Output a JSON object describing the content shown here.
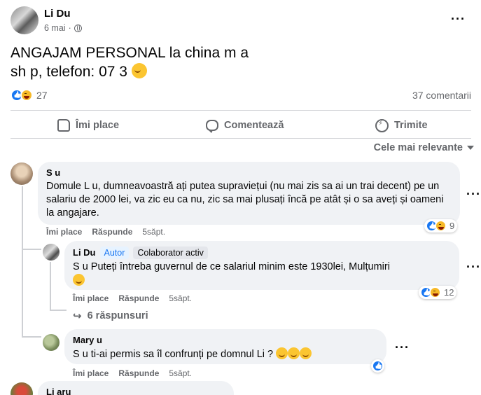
{
  "post": {
    "author": "Li      Du",
    "time": "6 mai",
    "text_line1": "ANGAJAM PERSONAL la china m    a",
    "text_line2": "sh  p, telefon: 07            3",
    "reactions_count": "27",
    "comments_count": "37 comentarii"
  },
  "actions": {
    "like": "Îmi place",
    "comment": "Comentează",
    "share": "Trimite"
  },
  "sort_label": "Cele mai relevante",
  "comments": [
    {
      "name": "S          u",
      "text": "Domule L          u, dumneavoastră ați putea supraviețui (nu mai zis sa ai un trai decent) pe un salariu de 2000 lei, va zic eu ca nu, zic sa mai plusați încă pe atât și o sa aveți și oameni la angajare.",
      "like": "Îmi place",
      "reply": "Răspunde",
      "time": "5săpt.",
      "reactions": "9"
    },
    {
      "name": "Li      Du",
      "badge_author": "Autor",
      "badge_active": "Colaborator activ",
      "text": "S          u Puteți întreba guvernul de ce salariul minim este 1930lei, Mulțumiri",
      "like": "Îmi place",
      "reply": "Răspunde",
      "time": "5săpt.",
      "reactions": "12",
      "replies": "6 răspunsuri"
    },
    {
      "name": "Mary      u",
      "text": "S          u ti-ai permis sa îl confrunți pe domnul Li      ?",
      "like": "Îmi place",
      "reply": "Răspunde",
      "time": "5săpt."
    },
    {
      "name": "Li         aru"
    }
  ],
  "icons": {
    "more": "more-dots-icon",
    "globe": "globe-icon",
    "like": "like-icon",
    "haha": "haha-icon",
    "comment": "comment-icon",
    "share": "share-icon"
  },
  "colors": {
    "accent": "#1877f2",
    "muted": "#65676b",
    "bubble": "#f0f2f5"
  }
}
